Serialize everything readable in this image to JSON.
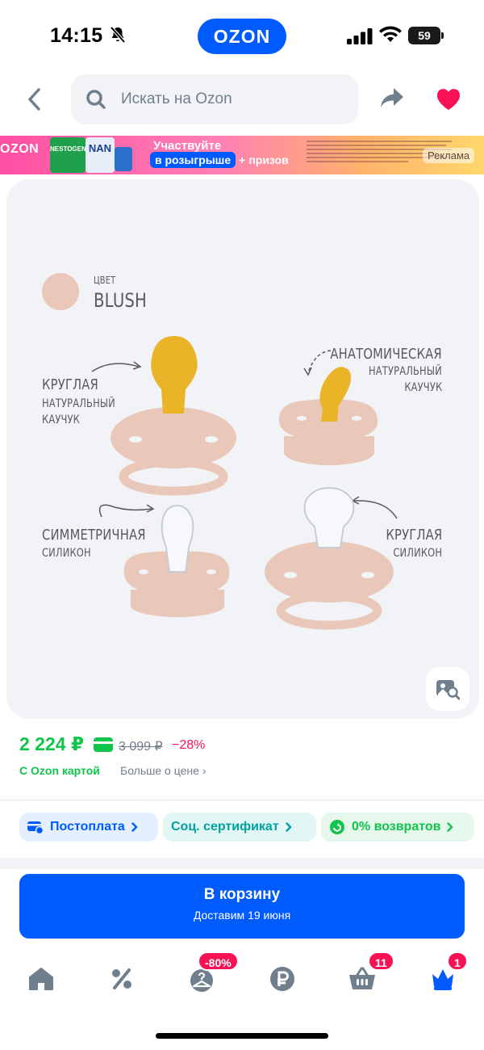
{
  "status_bar": {
    "time": "14:15",
    "app_pill": "OZON",
    "battery": "59"
  },
  "header": {
    "search_placeholder": "Искать на Ozon"
  },
  "ad_banner": {
    "logo": "OZON",
    "product_labels": [
      "NESTOGEN",
      "NAN"
    ],
    "line1": "Участвуйте",
    "line2_pill": "в розыгрыше",
    "line2_rest": "призов",
    "badge": "Реклама"
  },
  "gallery": {
    "color_label": "ЦВЕТ",
    "color_name": "BLUSH",
    "labels": {
      "round_natural": {
        "title": "КРУГЛАЯ",
        "line2": "НАТУРАЛЬНЫЙ",
        "line3": "КАУЧУК"
      },
      "anatomic_natural": {
        "title": "АНАТОМИЧЕСКАЯ",
        "line2": "НАТУРАЛЬНЫЙ",
        "line3": "КАУЧУК"
      },
      "symmetric_silicone": {
        "title": "СИММЕТРИЧНАЯ",
        "line2": "СИЛИКОН"
      },
      "round_silicone": {
        "title": "КРУГЛАЯ",
        "line2": "СИЛИКОН"
      }
    },
    "colors": {
      "background": "#f2f3f7",
      "pacifier": "#e9c7b9",
      "rubber": "#e9b428"
    }
  },
  "price": {
    "current": "2 224 ₽",
    "old": "3 099 ₽",
    "discount": "−28%",
    "ozon_card_label": "С Ozon картой",
    "more_label": "Больше о цене"
  },
  "chips": [
    {
      "label": "Постоплата",
      "icon": "postpay-icon"
    },
    {
      "label": "Соц. сертификат",
      "icon": ""
    },
    {
      "label": "0% возвратов",
      "icon": "return-icon"
    }
  ],
  "cart": {
    "label": "В корзину",
    "sub": "Доставим 19 июня"
  },
  "bottom_nav": {
    "items": [
      {
        "name": "home",
        "badge": ""
      },
      {
        "name": "discounts",
        "badge": ""
      },
      {
        "name": "fresh",
        "badge": "-80%"
      },
      {
        "name": "finance",
        "badge": ""
      },
      {
        "name": "cart",
        "badge": "11"
      },
      {
        "name": "profile",
        "badge": "1"
      }
    ]
  },
  "theme": {
    "brand_blue": "#005bff",
    "price_green": "#10c44c",
    "discount_red": "#f91155",
    "heart_pink": "#f91155"
  }
}
